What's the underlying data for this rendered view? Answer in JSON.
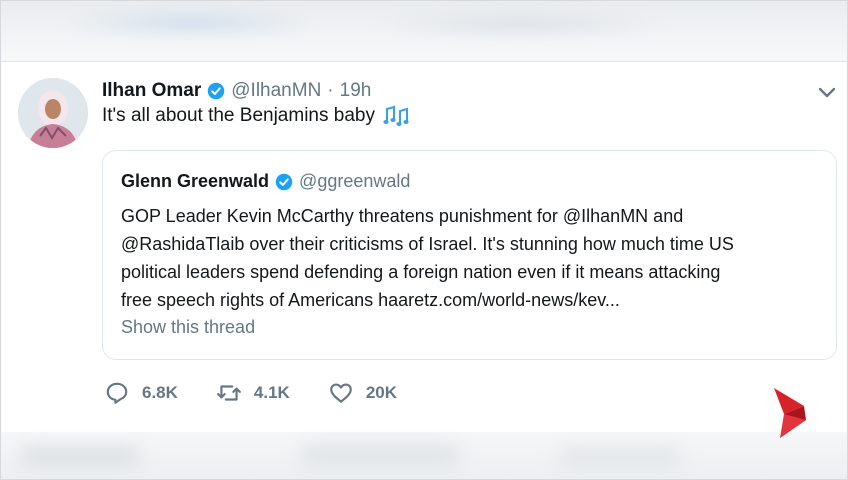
{
  "tweet": {
    "author": {
      "display_name": "Ilhan Omar",
      "handle": "@IlhanMN",
      "separator": "·",
      "time": "19h",
      "verified": true
    },
    "text": "It's all about the Benjamins baby",
    "emoji_icon": "musical-notes-icon",
    "quoted": {
      "display_name": "Glenn Greenwald",
      "handle": "@ggreenwald",
      "verified": true,
      "lines": [
        "GOP Leader Kevin McCarthy threatens punishment for @IlhanMN and",
        "@RashidaTlaib over their criticisms of Israel. It's stunning how much time US",
        "political leaders spend defending a foreign nation even if it means attacking",
        "free speech rights of Americans haaretz.com/world-news/kev..."
      ],
      "show_thread": "Show this thread"
    },
    "actions": {
      "replies": "6.8K",
      "retweets": "4.1K",
      "likes": "20K"
    }
  },
  "colors": {
    "verified_blue": "#1da1f2",
    "secondary_text": "#657786",
    "logo_red": "#d6232a"
  }
}
